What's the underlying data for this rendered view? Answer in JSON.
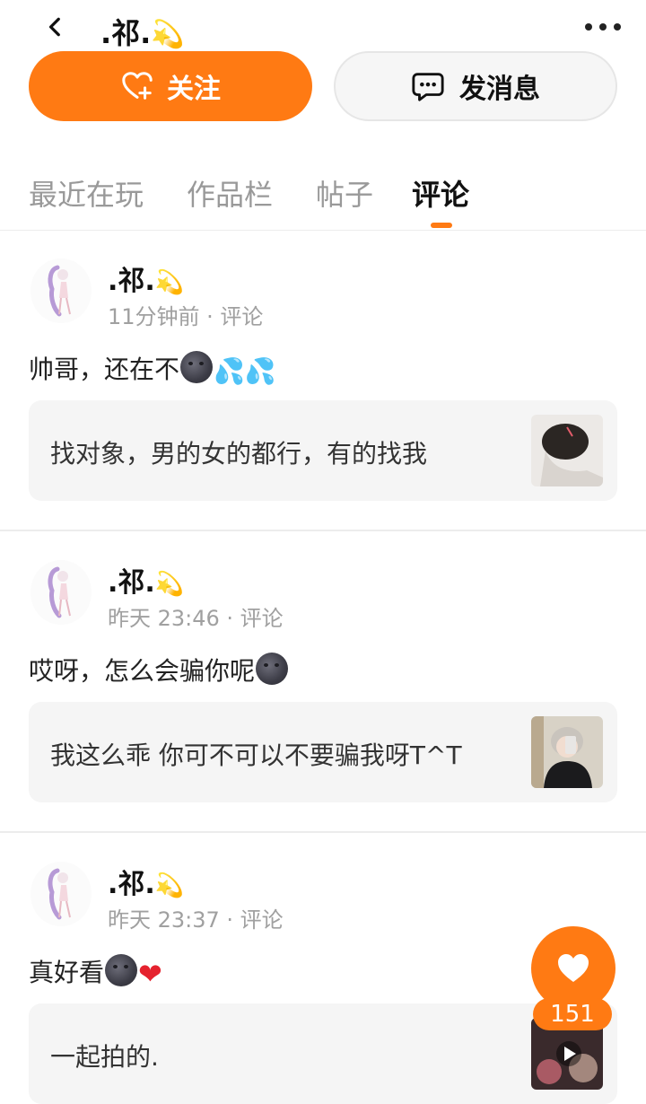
{
  "header": {
    "title": ".祁.",
    "title_emoji": "💫",
    "follow_label": "关注",
    "message_label": "发消息"
  },
  "tabs": [
    {
      "label": "最近在玩",
      "active": false
    },
    {
      "label": "作品栏",
      "active": false
    },
    {
      "label": "帖子",
      "active": false
    },
    {
      "label": "评论",
      "active": true
    }
  ],
  "comments": [
    {
      "username": ".祁.",
      "user_emoji": "💫",
      "meta": "11分钟前 · 评论",
      "text": "帅哥，还在不",
      "emojis": [
        "new-moon-face",
        "sweat-droplets",
        "sweat-droplets"
      ],
      "quoted": "找对象，男的女的都行，有的找我"
    },
    {
      "username": ".祁.",
      "user_emoji": "💫",
      "meta": "昨天 23:46 · 评论",
      "text": "哎呀，怎么会骗你呢",
      "emojis": [
        "new-moon-face"
      ],
      "quoted": "我这么乖 你可不可以不要骗我呀T^T"
    },
    {
      "username": ".祁.",
      "user_emoji": "💫",
      "meta": "昨天 23:37 · 评论",
      "text": "真好看",
      "emojis": [
        "new-moon-face",
        "red-heart"
      ],
      "quoted": "一起拍的."
    }
  ],
  "like": {
    "count": "151"
  },
  "colors": {
    "accent": "#ff7a13",
    "muted": "#a0a0a0",
    "quote_bg": "#f5f5f5"
  }
}
